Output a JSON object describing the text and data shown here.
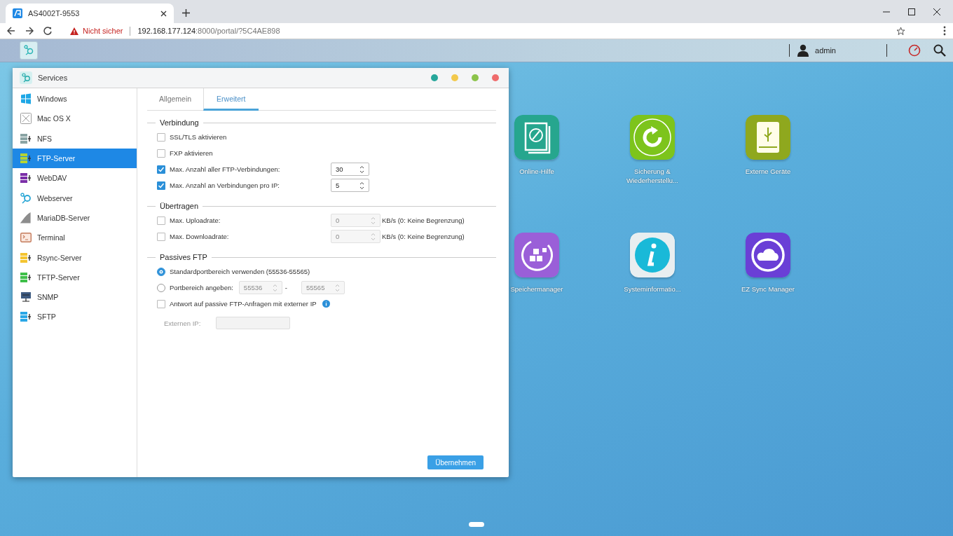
{
  "browser": {
    "tab_title": "AS4002T-9553",
    "security": "Nicht sicher",
    "url_host": "192.168.177.124",
    "url_path": ":8000/portal/?5C4AE898"
  },
  "nas_bar": {
    "user": "admin"
  },
  "window": {
    "title": "Services",
    "controls": [
      {
        "color": "#26a69a"
      },
      {
        "color": "#f2c94c"
      },
      {
        "color": "#8bc34a"
      },
      {
        "color": "#ef6c6c"
      }
    ]
  },
  "sidebar": {
    "items": [
      {
        "label": "Windows",
        "selected": false,
        "kind": "windows",
        "color": "#1ea7e6"
      },
      {
        "label": "Mac OS X",
        "selected": false,
        "kind": "cross",
        "color": "#9e9e9e"
      },
      {
        "label": "NFS",
        "selected": false,
        "kind": "stack",
        "color": "#8aa4a4"
      },
      {
        "label": "FTP-Server",
        "selected": true,
        "kind": "stack",
        "color": "#b5d334"
      },
      {
        "label": "WebDAV",
        "selected": false,
        "kind": "stack",
        "color": "#7b2fa8"
      },
      {
        "label": "Webserver",
        "selected": false,
        "kind": "webserver",
        "color": "#2aa7d6"
      },
      {
        "label": "MariaDB-Server",
        "selected": false,
        "kind": "fin",
        "color": "#8d8d8d"
      },
      {
        "label": "Terminal",
        "selected": false,
        "kind": "terminal",
        "color": "#c47a5a"
      },
      {
        "label": "Rsync-Server",
        "selected": false,
        "kind": "stack",
        "color": "#f4c430"
      },
      {
        "label": "TFTP-Server",
        "selected": false,
        "kind": "stack",
        "color": "#3fbf4a"
      },
      {
        "label": "SNMP",
        "selected": false,
        "kind": "monitor",
        "color": "#3d5a80"
      },
      {
        "label": "SFTP",
        "selected": false,
        "kind": "stack",
        "color": "#2aa7e6"
      }
    ]
  },
  "tabs": [
    {
      "label": "Allgemein",
      "selected": false
    },
    {
      "label": "Erweitert",
      "selected": true
    }
  ],
  "sections": [
    {
      "title": "Verbindung",
      "rows": [
        {
          "kind": "checkbox",
          "label": "SSL/TLS aktivieren",
          "checked": false
        },
        {
          "kind": "checkbox",
          "label": "FXP aktivieren",
          "checked": false
        },
        {
          "kind": "checkbox_spin",
          "label": "Max. Anzahl aller FTP-Verbindungen:",
          "checked": true,
          "value": "30",
          "disabled": false
        },
        {
          "kind": "checkbox_spin",
          "label": "Max. Anzahl an Verbindungen pro IP:",
          "checked": true,
          "value": "5",
          "disabled": false
        }
      ]
    },
    {
      "title": "Übertragen",
      "rows": [
        {
          "kind": "checkbox_spin",
          "label": "Max. Uploadrate:",
          "checked": false,
          "value": "0",
          "disabled": true,
          "unit": "KB/s (0: Keine Begrenzung)"
        },
        {
          "kind": "checkbox_spin",
          "label": "Max. Downloadrate:",
          "checked": false,
          "value": "0",
          "disabled": true,
          "unit": "KB/s (0: Keine Begrenzung)"
        }
      ]
    },
    {
      "title": "Passives FTP",
      "rows": [
        {
          "kind": "radio",
          "label": "Standardportbereich verwenden (55536-55565)",
          "selected": true
        },
        {
          "kind": "radio_range",
          "label": "Portbereich angeben:",
          "selected": false,
          "from": "55536",
          "separator": "-",
          "to": "55565",
          "disabled": true
        },
        {
          "kind": "checkbox_info",
          "label": "Antwort auf passive FTP-Anfragen mit externer IP",
          "checked": false
        },
        {
          "kind": "text_field",
          "label": "Externen IP:",
          "disabled": true
        }
      ]
    }
  ],
  "apply_button": "Übernehmen",
  "desktop_apps": [
    {
      "label": "Online-Hilfe",
      "kind": "compass",
      "color": "#26a68e"
    },
    {
      "label": "Sicherung & Wiederherstellu...",
      "kind": "sync",
      "color": "#7dc41c"
    },
    {
      "label": "Externe Geräte",
      "kind": "usb",
      "color": "#8fa81e"
    },
    {
      "label": "Speichermanager",
      "kind": "storage",
      "color": "#9a5fd8"
    },
    {
      "label": "Systeminformatio...",
      "kind": "info",
      "color": "#e8eef0"
    },
    {
      "label": "EZ Sync Manager",
      "kind": "cloud",
      "color": "#6a3fd6"
    }
  ]
}
